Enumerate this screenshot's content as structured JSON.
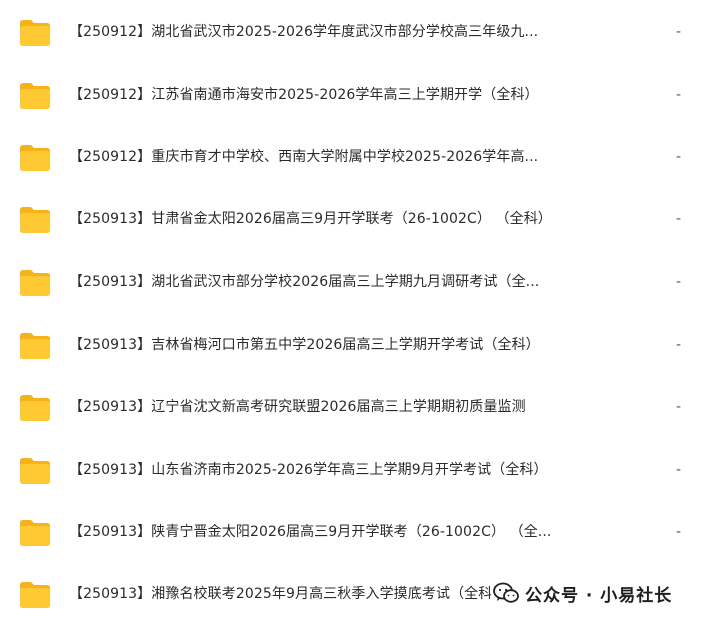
{
  "files": [
    {
      "name": "【250912】湖北省武汉市2025-2026学年度武汉市部分学校高三年级九...",
      "meta": "-"
    },
    {
      "name": "【250912】江苏省南通市海安市2025-2026学年高三上学期开学（全科）",
      "meta": "-"
    },
    {
      "name": "【250912】重庆市育才中学校、西南大学附属中学校2025-2026学年高...",
      "meta": "-"
    },
    {
      "name": "【250913】甘肃省金太阳2026届高三9月开学联考（26-1002C） （全科）",
      "meta": "-"
    },
    {
      "name": "【250913】湖北省武汉市部分学校2026届高三上学期九月调研考试（全...",
      "meta": "-"
    },
    {
      "name": "【250913】吉林省梅河口市第五中学2026届高三上学期开学考试（全科）",
      "meta": "-"
    },
    {
      "name": "【250913】辽宁省沈文新高考研究联盟2026届高三上学期期初质量监测",
      "meta": "-"
    },
    {
      "name": "【250913】山东省济南市2025-2026学年高三上学期9月开学考试（全科）",
      "meta": "-"
    },
    {
      "name": "【250913】陕青宁晋金太阳2026届高三9月开学联考（26-1002C） （全...",
      "meta": "-"
    },
    {
      "name": "【250913】湘豫名校联考2025年9月高三秋季入学摸底考试（全科）",
      "meta": ""
    }
  ],
  "watermark": {
    "text": "公众号 · 小易社长",
    "icon": "wechat-icon"
  },
  "colors": {
    "folder_body": "#FFC933",
    "folder_tab": "#F5B21A",
    "text": "#2B2B2B"
  }
}
